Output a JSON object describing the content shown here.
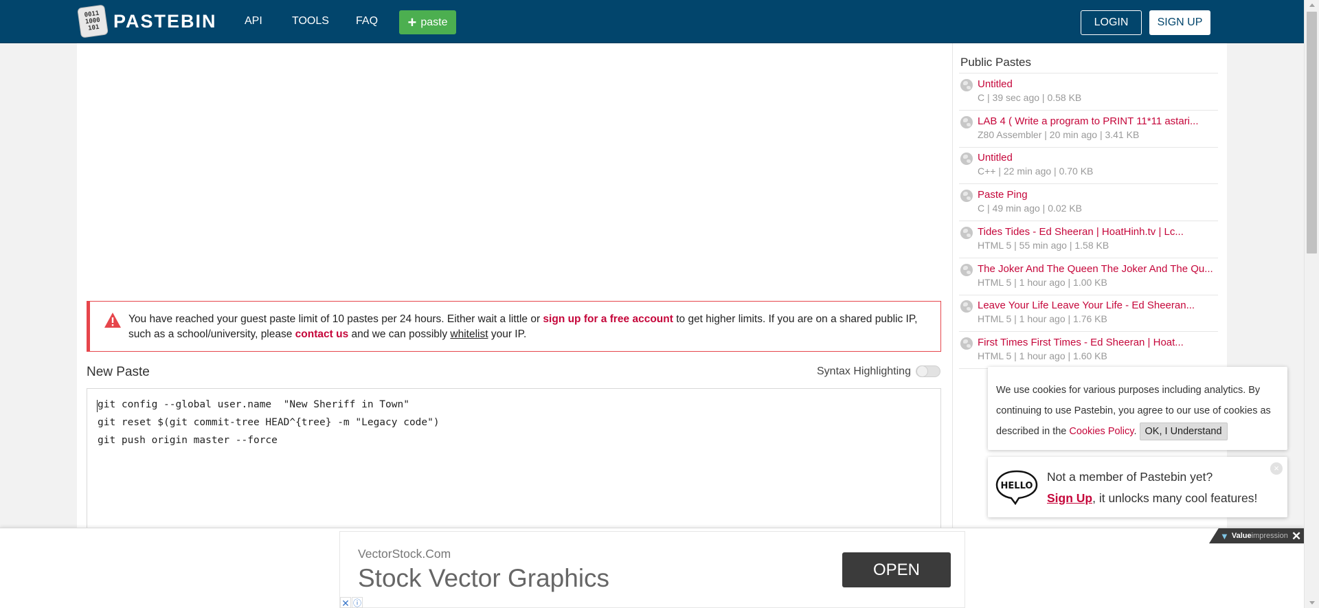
{
  "header": {
    "logo_text": "PASTEBIN",
    "logo_digits": [
      "0011",
      "1000",
      "101"
    ],
    "nav": [
      "API",
      "TOOLS",
      "FAQ"
    ],
    "paste_button": "paste",
    "login": "LOGIN",
    "signup": "SIGN UP",
    "bg_color": "#02456c"
  },
  "alert": {
    "text_1": "You have reached your guest paste limit of 10 pastes per 24 hours. Either wait a little or ",
    "link_signup": "sign up for a free account",
    "text_2": " to get higher limits. If you are on a shared public IP, such as a school/university, please ",
    "link_contact": "contact us",
    "text_3": " and we can possibly ",
    "link_whitelist": "whitelist",
    "text_4": " your IP."
  },
  "editor": {
    "title": "New Paste",
    "syntax_label": "Syntax Highlighting",
    "syntax_enabled": false,
    "lines": [
      "git config --global user.name  \"New Sheriff in Town\"",
      "git reset $(git commit-tree HEAD^{tree} -m \"Legacy code\")",
      "git push origin master --force"
    ]
  },
  "sidebar": {
    "title": "Public Pastes",
    "items": [
      {
        "title": "Untitled",
        "meta": "C | 39 sec ago | 0.58 KB"
      },
      {
        "title": "LAB 4 ( Write a program to PRINT 11*11 astari...",
        "meta": "Z80 Assembler | 20 min ago | 3.41 KB"
      },
      {
        "title": "Untitled",
        "meta": "C++ | 22 min ago | 0.70 KB"
      },
      {
        "title": "Paste Ping",
        "meta": "C | 49 min ago | 0.02 KB"
      },
      {
        "title": "Tides Tides - Ed Sheeran | HoatHinh.tv | Lc...",
        "meta": "HTML 5 | 55 min ago | 1.58 KB"
      },
      {
        "title": "The Joker And The Queen The Joker And The Qu...",
        "meta": "HTML 5 | 1 hour ago | 1.00 KB"
      },
      {
        "title": "Leave Your Life Leave Your Life - Ed Sheeran...",
        "meta": "HTML 5 | 1 hour ago | 1.76 KB"
      },
      {
        "title": "First Times First Times - Ed Sheeran | Hoat...",
        "meta": "HTML 5 | 1 hour ago | 1.60 KB"
      }
    ]
  },
  "cookie": {
    "text_1": "We use cookies for various purposes including analytics. By continuing to use Pastebin, you agree to our use of cookies as described in the ",
    "link": "Cookies Policy",
    "text_2": ". ",
    "ok_button": "OK, I Understand"
  },
  "member_popup": {
    "hello": "HELLO",
    "line1": "Not a member of Pastebin yet?",
    "signup_link": "Sign Up",
    "line2_rest": ", it unlocks many cool features!",
    "close": "×"
  },
  "ad": {
    "small_text": "VectorStock.Com",
    "big_text": "Stock Vector Graphics",
    "open_button": "OPEN",
    "badge_text": "Value",
    "badge_text2": "impression",
    "close": "✕"
  }
}
